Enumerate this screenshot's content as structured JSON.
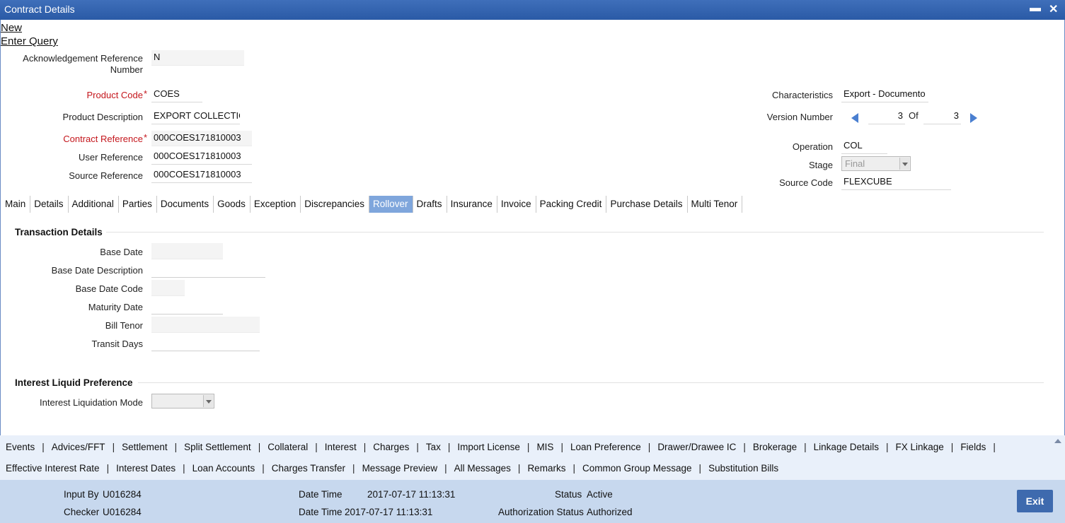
{
  "window": {
    "title": "Contract Details",
    "minimize_label": "▬",
    "close_label": "✕"
  },
  "toolbar": {
    "new_label": "New",
    "enter_query_label": "Enter Query"
  },
  "header": {
    "ack_ref_label_1": "Acknowledgement Reference",
    "ack_ref_label_2": "Number",
    "ack_ref_value": "N",
    "product_code_label": "Product Code",
    "product_code_value": "COES",
    "product_desc_label": "Product Description",
    "product_desc_value": "EXPORT COLLECTIO",
    "contract_ref_label": "Contract Reference",
    "contract_ref_value": "000COES171810003",
    "user_ref_label": "User Reference",
    "user_ref_value": "000COES171810003",
    "source_ref_label": "Source Reference",
    "source_ref_value": "000COES171810003",
    "required_marker": "*",
    "characteristics_label": "Characteristics",
    "characteristics_value": "Export  - Documento",
    "version_label": "Version Number",
    "version_current": "3",
    "version_of": "Of",
    "version_total": "3",
    "operation_label": "Operation",
    "operation_value": "COL",
    "stage_label": "Stage",
    "stage_value": "Final",
    "source_code_label": "Source Code",
    "source_code_value": "FLEXCUBE"
  },
  "tabs": [
    {
      "label": "Main"
    },
    {
      "label": "Details"
    },
    {
      "label": "Additional"
    },
    {
      "label": "Parties"
    },
    {
      "label": "Documents"
    },
    {
      "label": "Goods"
    },
    {
      "label": "Exception"
    },
    {
      "label": "Discrepancies"
    },
    {
      "label": "Rollover"
    },
    {
      "label": "Drafts"
    },
    {
      "label": "Insurance"
    },
    {
      "label": "Invoice"
    },
    {
      "label": "Packing Credit"
    },
    {
      "label": "Purchase Details"
    },
    {
      "label": "Multi Tenor"
    }
  ],
  "rollover": {
    "transaction_details_title": "Transaction Details",
    "base_date_label": "Base Date",
    "base_date_value": "",
    "base_date_desc_label": "Base Date Description",
    "base_date_desc_value": "",
    "base_date_code_label": "Base Date Code",
    "base_date_code_value": "",
    "maturity_date_label": "Maturity Date",
    "maturity_date_value": "",
    "bill_tenor_label": "Bill Tenor",
    "bill_tenor_value": "",
    "transit_days_label": "Transit Days",
    "transit_days_value": "",
    "interest_pref_title": "Interest Liquid Preference",
    "interest_mode_label": "Interest Liquidation Mode",
    "interest_mode_value": ""
  },
  "links_row1": [
    "Events",
    "Advices/FFT",
    "Settlement",
    "Split Settlement",
    "Collateral",
    "Interest",
    "Charges",
    "Tax",
    "Import License",
    "MIS",
    "Loan Preference",
    "Drawer/Drawee IC",
    "Brokerage",
    "Linkage Details",
    "FX Linkage",
    "Fields"
  ],
  "links_row2": [
    "Effective Interest Rate",
    "Interest Dates",
    "Loan Accounts",
    "Charges Transfer",
    "Message Preview",
    "All Messages",
    "Remarks",
    "Common Group Message",
    "Substitution Bills"
  ],
  "link_separator": "|",
  "footer": {
    "input_by_label": "Input By",
    "input_by_value": "U016284",
    "checker_label": "Checker",
    "checker_value": "U016284",
    "date_time_label": "Date Time",
    "input_date_time": "2017-07-17 11:13:31",
    "checker_date_time": "2017-07-17 11:13:31",
    "status_label": "Status",
    "status_value": "Active",
    "auth_status_label": "Authorization Status",
    "auth_status_value": "Authorized",
    "exit_label": "Exit"
  }
}
